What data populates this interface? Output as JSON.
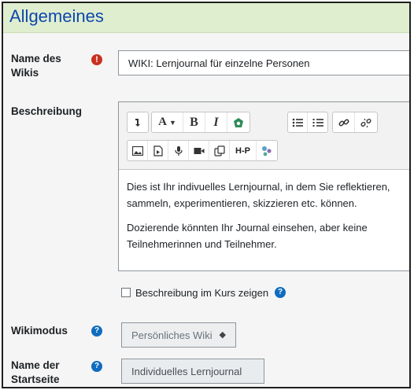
{
  "section": {
    "title": "Allgemeines"
  },
  "fields": {
    "name": {
      "label_line1": "Name des",
      "label_line2": "Wikis",
      "value": "WIKI: Lernjournal für einzelne Personen",
      "required_icon": "exclamation-circle-icon"
    },
    "description": {
      "label": "Beschreibung",
      "toolbar": {
        "row1": [
          "collapse-icon",
          "font-icon",
          "bold-icon",
          "italic-icon",
          "color-icon",
          "bullet-list-icon",
          "numbered-list-icon",
          "link-icon",
          "unlink-icon"
        ],
        "row2": [
          "image-icon",
          "media-icon",
          "microphone-icon",
          "video-icon",
          "copy-icon",
          "h5p-icon",
          "bubbles-icon"
        ],
        "bold_glyph": "B",
        "italic_glyph": "I",
        "font_glyph": "A",
        "h5p_glyph": "H-P"
      },
      "content": {
        "p1": "Dies ist Ihr indivuelles Lernjournal, in dem Sie reflektieren, sammeln, experimentieren, skizzieren etc. können.",
        "p2": "Dozierende könnten Ihr Journal einsehen, aber keine Teilnehmerinnen und Teilnehmer."
      },
      "show_in_course_label": "Beschreibung im Kurs zeigen",
      "show_in_course_checked": false
    },
    "wikimode": {
      "label": "Wikimodus",
      "selected": "Persönliches Wiki"
    },
    "start_page": {
      "label_line1": "Name der",
      "label_line2": "Startseite",
      "value": "Individuelles Lernjournal"
    }
  },
  "colors": {
    "header_bg": "#dfeecf",
    "title": "#0f47ad",
    "required": "#ca3120",
    "help": "#0f6cbf"
  }
}
